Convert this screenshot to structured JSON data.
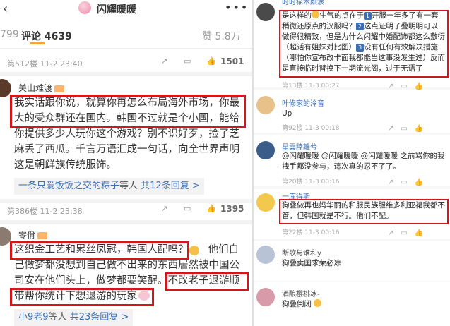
{
  "header": {
    "back": "‹",
    "title": "闪耀暖暖",
    "more": "•••"
  },
  "tabs": {
    "prev": "799",
    "comments": "评论 4639",
    "likes": "赞 5.8万"
  },
  "left_comments": [
    {
      "floor": "第512楼 11-2 23:40",
      "likes": "1501",
      "user": "关山难渡",
      "lines": [
        "我实话跟你说，就算你再怎么布局海外市场，你最",
        "大的受众群还在国内。韩国不过就是个小国，能给",
        "你提供多少人玩你这个游戏？别不识好歹，捡了芝",
        "麻丢了西瓜。千言万语汇成一句话，向全世界声明",
        "这是朝鲜族传统服饰。"
      ],
      "replies": {
        "link": "一条只爱饭饭之交的粽子",
        "text": "等人",
        "count": "共12条回复 >"
      }
    },
    {
      "floor": "第386楼 11-2 23:38",
      "likes": "1395",
      "user": "零佾",
      "lines": [
        "这织金工艺和累丝凤冠，韩国人配吗？",
        "己做梦都没想到自己做不出来的东西居然被中国公",
        "司安在他们头上，做梦都要笑醒。",
        "带帮你统计下想退游的玩家"
      ],
      "line1_tail": "他们自",
      "line3_tail": "不改老子退游顺",
      "replies": {
        "link": "小9老9",
        "text": "等人",
        "count": "共23条回复 >"
      }
    }
  ],
  "right_comments": [
    {
      "name": "时时猫木颜浪",
      "lines": [
        "是这样的",
        "生气的点在于",
        "开服一年多了有一套",
        "稍微还原点的汉服吗？",
        "这点证明了叠明明可以",
        "做得很精致，但是为什么闪耀中婚配饰都这么敷衍",
        "（超话有姐妹对比图）",
        "没有任何有效解决措施",
        "（哪怕你宣布改卡面我都能当这事没发生过）反而",
        "是直接临时替换下一期流光阁，过于无语了"
      ],
      "nums": [
        "1",
        "2",
        "3"
      ],
      "meta": "第13楼 11-3 00:27"
    },
    {
      "name": "叶修家的泠音",
      "text": "Up",
      "meta": "第92楼 11-3 00:18"
    },
    {
      "name": "星雲陸離兮",
      "lines": [
        "@闪耀暖暖 @闪耀暖暖 @闪耀暖暖 之前骂你的我",
        "拽手都没参与，這次真的忍不了了。"
      ],
      "meta": "第20楼 11-3 00:16"
    },
    {
      "name": "一库得斯",
      "lines": [
        "狗叠做再也妈华丽的和服民族服维多利亚裙我都不",
        "管，但韩国就是不行。他们不配。"
      ],
      "meta": "第22楼 11-3 00:16"
    },
    {
      "name": "断歌与谁和y",
      "text": "狗叠卖国求荣必凉",
      "meta": ""
    },
    {
      "name": "酒酿樱桃冰-",
      "text": "狗叠倒闭",
      "meta": ""
    }
  ],
  "colors": {
    "highlight": "#d4161b",
    "link": "#3a6fb6",
    "accent": "#f7a33b"
  }
}
